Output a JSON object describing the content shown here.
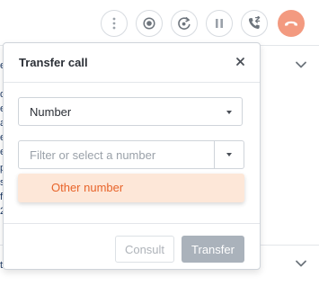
{
  "toolbar": {
    "buttons": [
      {
        "icon": "more-dots-icon"
      },
      {
        "icon": "record-icon"
      },
      {
        "icon": "refresh-call-icon"
      },
      {
        "icon": "pause-icon"
      },
      {
        "icon": "phone-transfer-icon"
      },
      {
        "icon": "hang-up-icon",
        "color": "#f39a80"
      }
    ]
  },
  "background": {
    "left_text_fragments": [
      "e",
      "d",
      "e",
      "a",
      "e",
      "e",
      "p",
      "s",
      "f",
      "2",
      "t"
    ]
  },
  "modal": {
    "title": "Transfer call",
    "close_icon": "close-icon",
    "type_select": {
      "value": "Number"
    },
    "filter": {
      "placeholder": "Filter or select a number",
      "value": ""
    },
    "dropdown": {
      "options": [
        {
          "label": "Other number",
          "highlighted": true
        }
      ]
    },
    "footer": {
      "consult_label": "Consult",
      "transfer_label": "Transfer"
    }
  },
  "colors": {
    "accent_orange": "#e8642a",
    "option_highlight_bg": "#fde7d8",
    "hangup_red": "#f39a80",
    "disabled_button_bg": "#aab2bb"
  }
}
